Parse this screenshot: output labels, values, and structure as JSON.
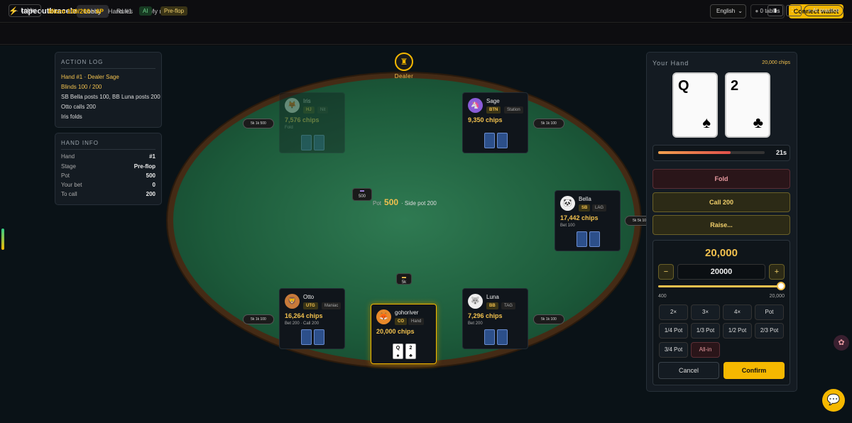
{
  "brand": {
    "name": "tapeoutbracelet"
  },
  "nav": {
    "lobby": "Lobby",
    "rules": "Rules",
    "my_numbers": "My numbers"
  },
  "header": {
    "language": "English",
    "tables": "0 tables",
    "connect": "Connect wallet"
  },
  "subbar": {
    "back": "← Lobby",
    "table_name": "Micro 100/200 · 6P",
    "hand": "Hand #1",
    "ai_badge": "AI",
    "stage": "Pre-flop",
    "ai_practice": "AI practice"
  },
  "action_log": {
    "title": "Action log",
    "entries": [
      "Hand #1 · Dealer Sage",
      "Blinds 100 / 200",
      "SB Bella posts 100, BB Luna posts 200",
      "Otto calls 200",
      "Iris folds"
    ]
  },
  "hand_info": {
    "title": "Hand info",
    "rows": [
      {
        "label": "Hand",
        "value": "#1"
      },
      {
        "label": "Stage",
        "value": "Pre-flop"
      },
      {
        "label": "Pot",
        "value": "500"
      },
      {
        "label": "Your bet",
        "value": "0"
      },
      {
        "label": "To call",
        "value": "200"
      }
    ]
  },
  "table": {
    "dealer_label": "Dealer",
    "pot_label": "Pot",
    "pot_value": "500",
    "side_pot": "· Side pot 200",
    "pot_chip": "500",
    "center_chip": "5k"
  },
  "seats": {
    "iris": {
      "name": "Iris",
      "pos": "HJ",
      "style": "Nit",
      "chips": "7,576 chips",
      "bet": "Fold"
    },
    "sage": {
      "name": "Sage",
      "pos": "BTN",
      "style": "Station",
      "chips": "9,350 chips",
      "bet": ""
    },
    "bella": {
      "name": "Bella",
      "pos": "SB",
      "style": "LAG",
      "chips": "17,442 chips",
      "bet": "Bet 100"
    },
    "luna": {
      "name": "Luna",
      "pos": "BB",
      "style": "TAG",
      "chips": "7,296 chips",
      "bet": "Bet 200"
    },
    "otto": {
      "name": "Otto",
      "pos": "UTG",
      "style": "Maniac",
      "chips": "16,264 chips",
      "bet": "Bet 200 · Call 200"
    },
    "hero": {
      "name": "gohoriver",
      "pos": "CO",
      "style": "Hand",
      "chips": "20,000 chips",
      "card1": "Q",
      "card2": "2"
    }
  },
  "stacks": {
    "left_top": "5k 1k 500",
    "right_top": "5k 1k 100",
    "right_mid": "5k 5k 100",
    "left_bottom": "5k 1k 100",
    "right_bottom": "5k 1k 100"
  },
  "your_hand": {
    "title": "Your Hand",
    "chips": "20,000 chips",
    "cards": [
      {
        "rank": "Q",
        "suit": "♠"
      },
      {
        "rank": "2",
        "suit": "♣"
      }
    ],
    "timer": "21s",
    "timer_fraction": 0.68
  },
  "actions": {
    "fold": "Fold",
    "call": "Call 200",
    "raise": "Raise..."
  },
  "raise": {
    "amount_display": "20,000",
    "input_value": "20000",
    "minus": "−",
    "plus": "+",
    "min": "400",
    "max": "20,000",
    "presets": [
      "2×",
      "3×",
      "4×",
      "Pot",
      "1/4 Pot",
      "1/3 Pot",
      "1/2 Pot",
      "2/3 Pot",
      "3/4 Pot",
      "All-in"
    ],
    "cancel": "Cancel",
    "confirm": "Confirm"
  },
  "colors": {
    "accent": "#f5b800",
    "felt": "#1c5a3a",
    "fold": "#e89aa0"
  }
}
